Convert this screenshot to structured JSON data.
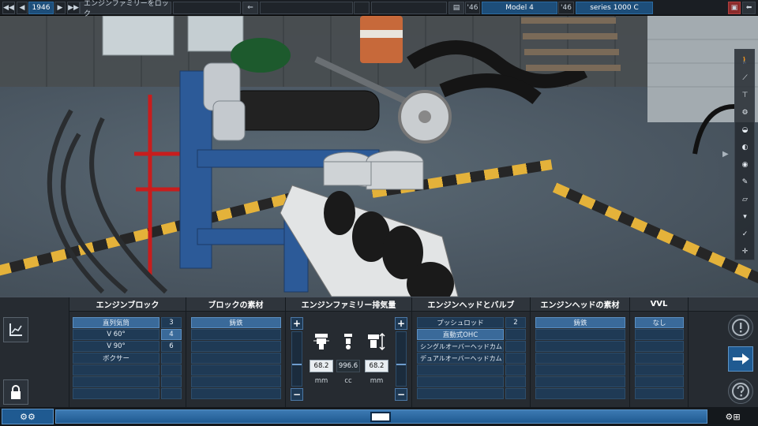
{
  "topbar": {
    "year": "1946",
    "lock_family_label": "エンジンファミリーをロック",
    "model_year": "'46",
    "model_name": "Model 4",
    "trim_year": "'46",
    "trim_name": "series 1000 C"
  },
  "columns": {
    "block": {
      "title": "エンジンブロック",
      "layouts": [
        "直列気筒",
        "V 60°",
        "V 90°",
        "ボクサー"
      ],
      "selected_layout": "直列気筒",
      "cylinders": [
        "3",
        "4",
        "6"
      ],
      "selected_cylinders": "4"
    },
    "block_material": {
      "title": "ブロックの素材",
      "options": [
        "鋳鉄"
      ],
      "selected": "鋳鉄"
    },
    "displacement": {
      "title": "エンジンファミリー排気量",
      "bore": "68.2",
      "displacement": "996.6",
      "stroke": "68.2",
      "bore_unit": "mm",
      "displacement_unit": "cc",
      "stroke_unit": "mm",
      "plus": "+",
      "minus": "−"
    },
    "head": {
      "title": "エンジンヘッドとバルブ",
      "options": [
        "プッシュロッド",
        "直動式OHC",
        "シングルオーバーヘッドカム",
        "デュアルオーバーヘッドカム"
      ],
      "selected": "直動式OHC",
      "valves": [
        "2"
      ],
      "selected_valves": "2"
    },
    "head_material": {
      "title": "エンジンヘッドの素材",
      "options": [
        "鋳鉄"
      ],
      "selected": "鋳鉄"
    },
    "vvl": {
      "title": "VVL",
      "options": [
        "なし"
      ],
      "selected": "なし"
    }
  },
  "icons": {
    "graph": "graph-axes-icon",
    "lock": "padlock-icon",
    "info": "exclamation-circle-icon",
    "next": "arrow-right-icon",
    "help": "question-circle-icon",
    "bore_gauge": "bore-icon",
    "displacement_gauge": "piston-icon",
    "stroke_gauge": "stroke-icon"
  },
  "colors": {
    "accent": "#3a6a9a",
    "panel": "#262b31",
    "nav": "#1f5a91",
    "field": "#1d4e7a"
  }
}
